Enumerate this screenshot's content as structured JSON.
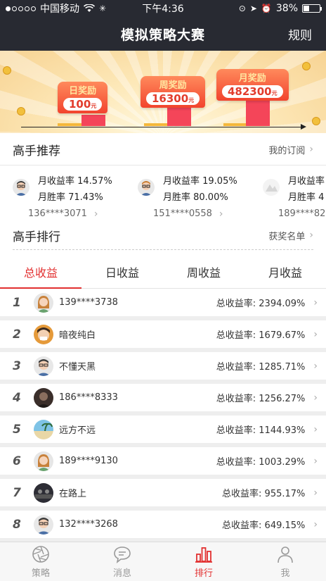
{
  "status": {
    "carrier": "中国移动",
    "time": "下午4:36",
    "battery": "38%",
    "battery_level": 0.38
  },
  "nav": {
    "title": "模拟策略大赛",
    "action": "规则"
  },
  "banner": {
    "prizes": [
      {
        "label": "日奖励",
        "value": "100",
        "unit": "元"
      },
      {
        "label": "周奖励",
        "value": "16300",
        "unit": "元"
      },
      {
        "label": "月奖励",
        "value": "482300",
        "unit": "元"
      }
    ]
  },
  "experts_section": {
    "title": "高手推荐",
    "link": "我的订阅"
  },
  "experts": [
    {
      "monthly_return": "月收益率 14.57%",
      "monthly_winrate": "月胜率 71.43%",
      "user": "136****3071",
      "avatar": "man-glasses-avatar"
    },
    {
      "monthly_return": "月收益率 19.05%",
      "monthly_winrate": "月胜率 80.00%",
      "user": "151****0558",
      "avatar": "man-glasses-avatar"
    },
    {
      "monthly_return": "月收益率",
      "monthly_winrate": "月胜率 4",
      "user": "189****82",
      "avatar": "photo-avatar"
    }
  ],
  "ranking_section": {
    "title": "高手排行",
    "link": "获奖名单"
  },
  "tabs": [
    {
      "label": "总收益",
      "active": true
    },
    {
      "label": "日收益",
      "active": false
    },
    {
      "label": "周收益",
      "active": false
    },
    {
      "label": "月收益",
      "active": false
    }
  ],
  "rankings": [
    {
      "rank": "1",
      "name": "139****3738",
      "rate": "总收益率: 2394.09%",
      "avatar": "woman-avatar"
    },
    {
      "rank": "2",
      "name": "暗夜纯白",
      "rate": "总收益率: 1679.67%",
      "avatar": "photo-avatar"
    },
    {
      "rank": "3",
      "name": "不懂天黑",
      "rate": "总收益率: 1285.71%",
      "avatar": "man-glasses-avatar"
    },
    {
      "rank": "4",
      "name": "186****8333",
      "rate": "总收益率: 1256.27%",
      "avatar": "photo-avatar"
    },
    {
      "rank": "5",
      "name": "远方不远",
      "rate": "总收益率: 1144.93%",
      "avatar": "beach-avatar"
    },
    {
      "rank": "6",
      "name": "189****9130",
      "rate": "总收益率: 1003.29%",
      "avatar": "woman-avatar"
    },
    {
      "rank": "7",
      "name": "在路上",
      "rate": "总收益率: 955.17%",
      "avatar": "photo-avatar"
    },
    {
      "rank": "8",
      "name": "132****3268",
      "rate": "总收益率: 649.15%",
      "avatar": "man-glasses-avatar"
    }
  ],
  "tabbar": [
    {
      "label": "策略",
      "icon": "aperture-icon",
      "active": false
    },
    {
      "label": "消息",
      "icon": "message-icon",
      "active": false
    },
    {
      "label": "排行",
      "icon": "bar-chart-icon",
      "active": true
    },
    {
      "label": "我",
      "icon": "person-icon",
      "active": false
    }
  ],
  "colors": {
    "accent": "#e23030",
    "nav_bg": "#282a32"
  }
}
